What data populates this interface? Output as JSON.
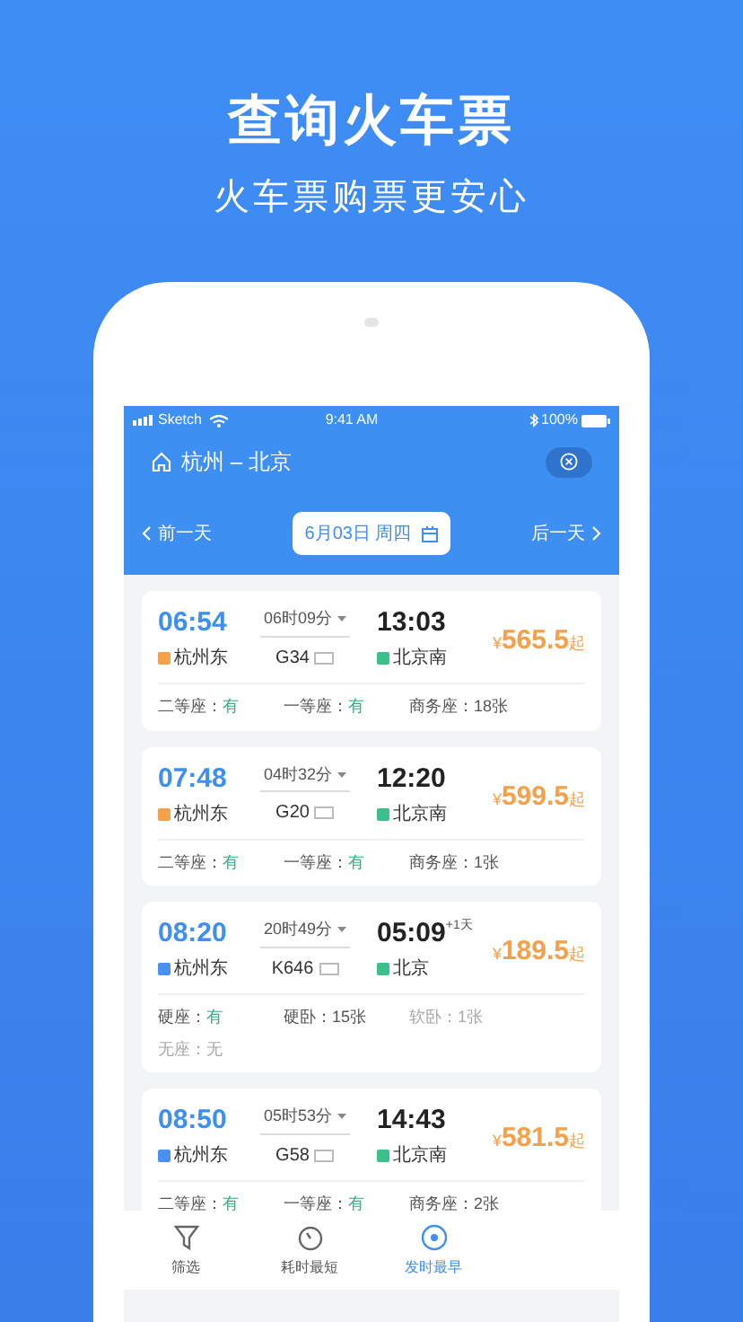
{
  "promo": {
    "title": "查询火车票",
    "subtitle": "火车票购票更安心"
  },
  "status_bar": {
    "carrier": "Sketch",
    "time": "9:41 AM",
    "battery": "100%"
  },
  "header": {
    "route": "杭州 – 北京"
  },
  "date_bar": {
    "prev": "前一天",
    "date": "6月03日 周四",
    "next": "后一天"
  },
  "trains": [
    {
      "depart": "06:54",
      "depart_station": {
        "name": "杭州东",
        "color": "#f5a04a"
      },
      "duration": "06时09分",
      "train_no": "G34",
      "arrive": "13:03",
      "arrive_station": {
        "name": "北京南",
        "color": "#3cc08a"
      },
      "price": "565.5",
      "currency": "¥",
      "from": "起",
      "seats": [
        {
          "label": "二等座：",
          "value": "有",
          "available": true,
          "disabled": false
        },
        {
          "label": "一等座：",
          "value": "有",
          "available": true,
          "disabled": false
        },
        {
          "label": "商务座：",
          "value": "18张",
          "available": false,
          "disabled": false
        }
      ]
    },
    {
      "depart": "07:48",
      "depart_station": {
        "name": "杭州东",
        "color": "#f5a04a"
      },
      "duration": "04时32分",
      "train_no": "G20",
      "arrive": "12:20",
      "arrive_station": {
        "name": "北京南",
        "color": "#3cc08a"
      },
      "price": "599.5",
      "currency": "¥",
      "from": "起",
      "seats": [
        {
          "label": "二等座：",
          "value": "有",
          "available": true,
          "disabled": false
        },
        {
          "label": "一等座：",
          "value": "有",
          "available": true,
          "disabled": false
        },
        {
          "label": "商务座：",
          "value": "1张",
          "available": false,
          "disabled": false
        }
      ]
    },
    {
      "depart": "08:20",
      "depart_station": {
        "name": "杭州东",
        "color": "#4a90f0"
      },
      "duration": "20时49分",
      "train_no": "K646",
      "arrive": "05:09",
      "arrive_station": {
        "name": "北京",
        "color": "#3cc08a"
      },
      "next_day": "+1天",
      "price": "189.5",
      "currency": "¥",
      "from": "起",
      "seats": [
        {
          "label": "硬座：",
          "value": "有",
          "available": true,
          "disabled": false
        },
        {
          "label": "硬卧：",
          "value": "15张",
          "available": false,
          "disabled": false
        },
        {
          "label": "软卧：",
          "value": "1张",
          "available": false,
          "disabled": true
        },
        {
          "label": "无座：",
          "value": "无",
          "available": false,
          "disabled": true
        }
      ]
    },
    {
      "depart": "08:50",
      "depart_station": {
        "name": "杭州东",
        "color": "#4a90f0"
      },
      "duration": "05时53分",
      "train_no": "G58",
      "arrive": "14:43",
      "arrive_station": {
        "name": "北京南",
        "color": "#3cc08a"
      },
      "price": "581.5",
      "currency": "¥",
      "from": "起",
      "seats": [
        {
          "label": "二等座：",
          "value": "有",
          "available": true,
          "disabled": false
        },
        {
          "label": "一等座：",
          "value": "有",
          "available": true,
          "disabled": false
        },
        {
          "label": "商务座：",
          "value": "2张",
          "available": false,
          "disabled": false
        }
      ]
    }
  ],
  "tab_bar": [
    {
      "label": "筛选",
      "kind": "filter",
      "selected": false
    },
    {
      "label": "耗时最短",
      "kind": "timer",
      "selected": false
    },
    {
      "label": "发时最早",
      "kind": "clock24",
      "selected": true
    }
  ]
}
